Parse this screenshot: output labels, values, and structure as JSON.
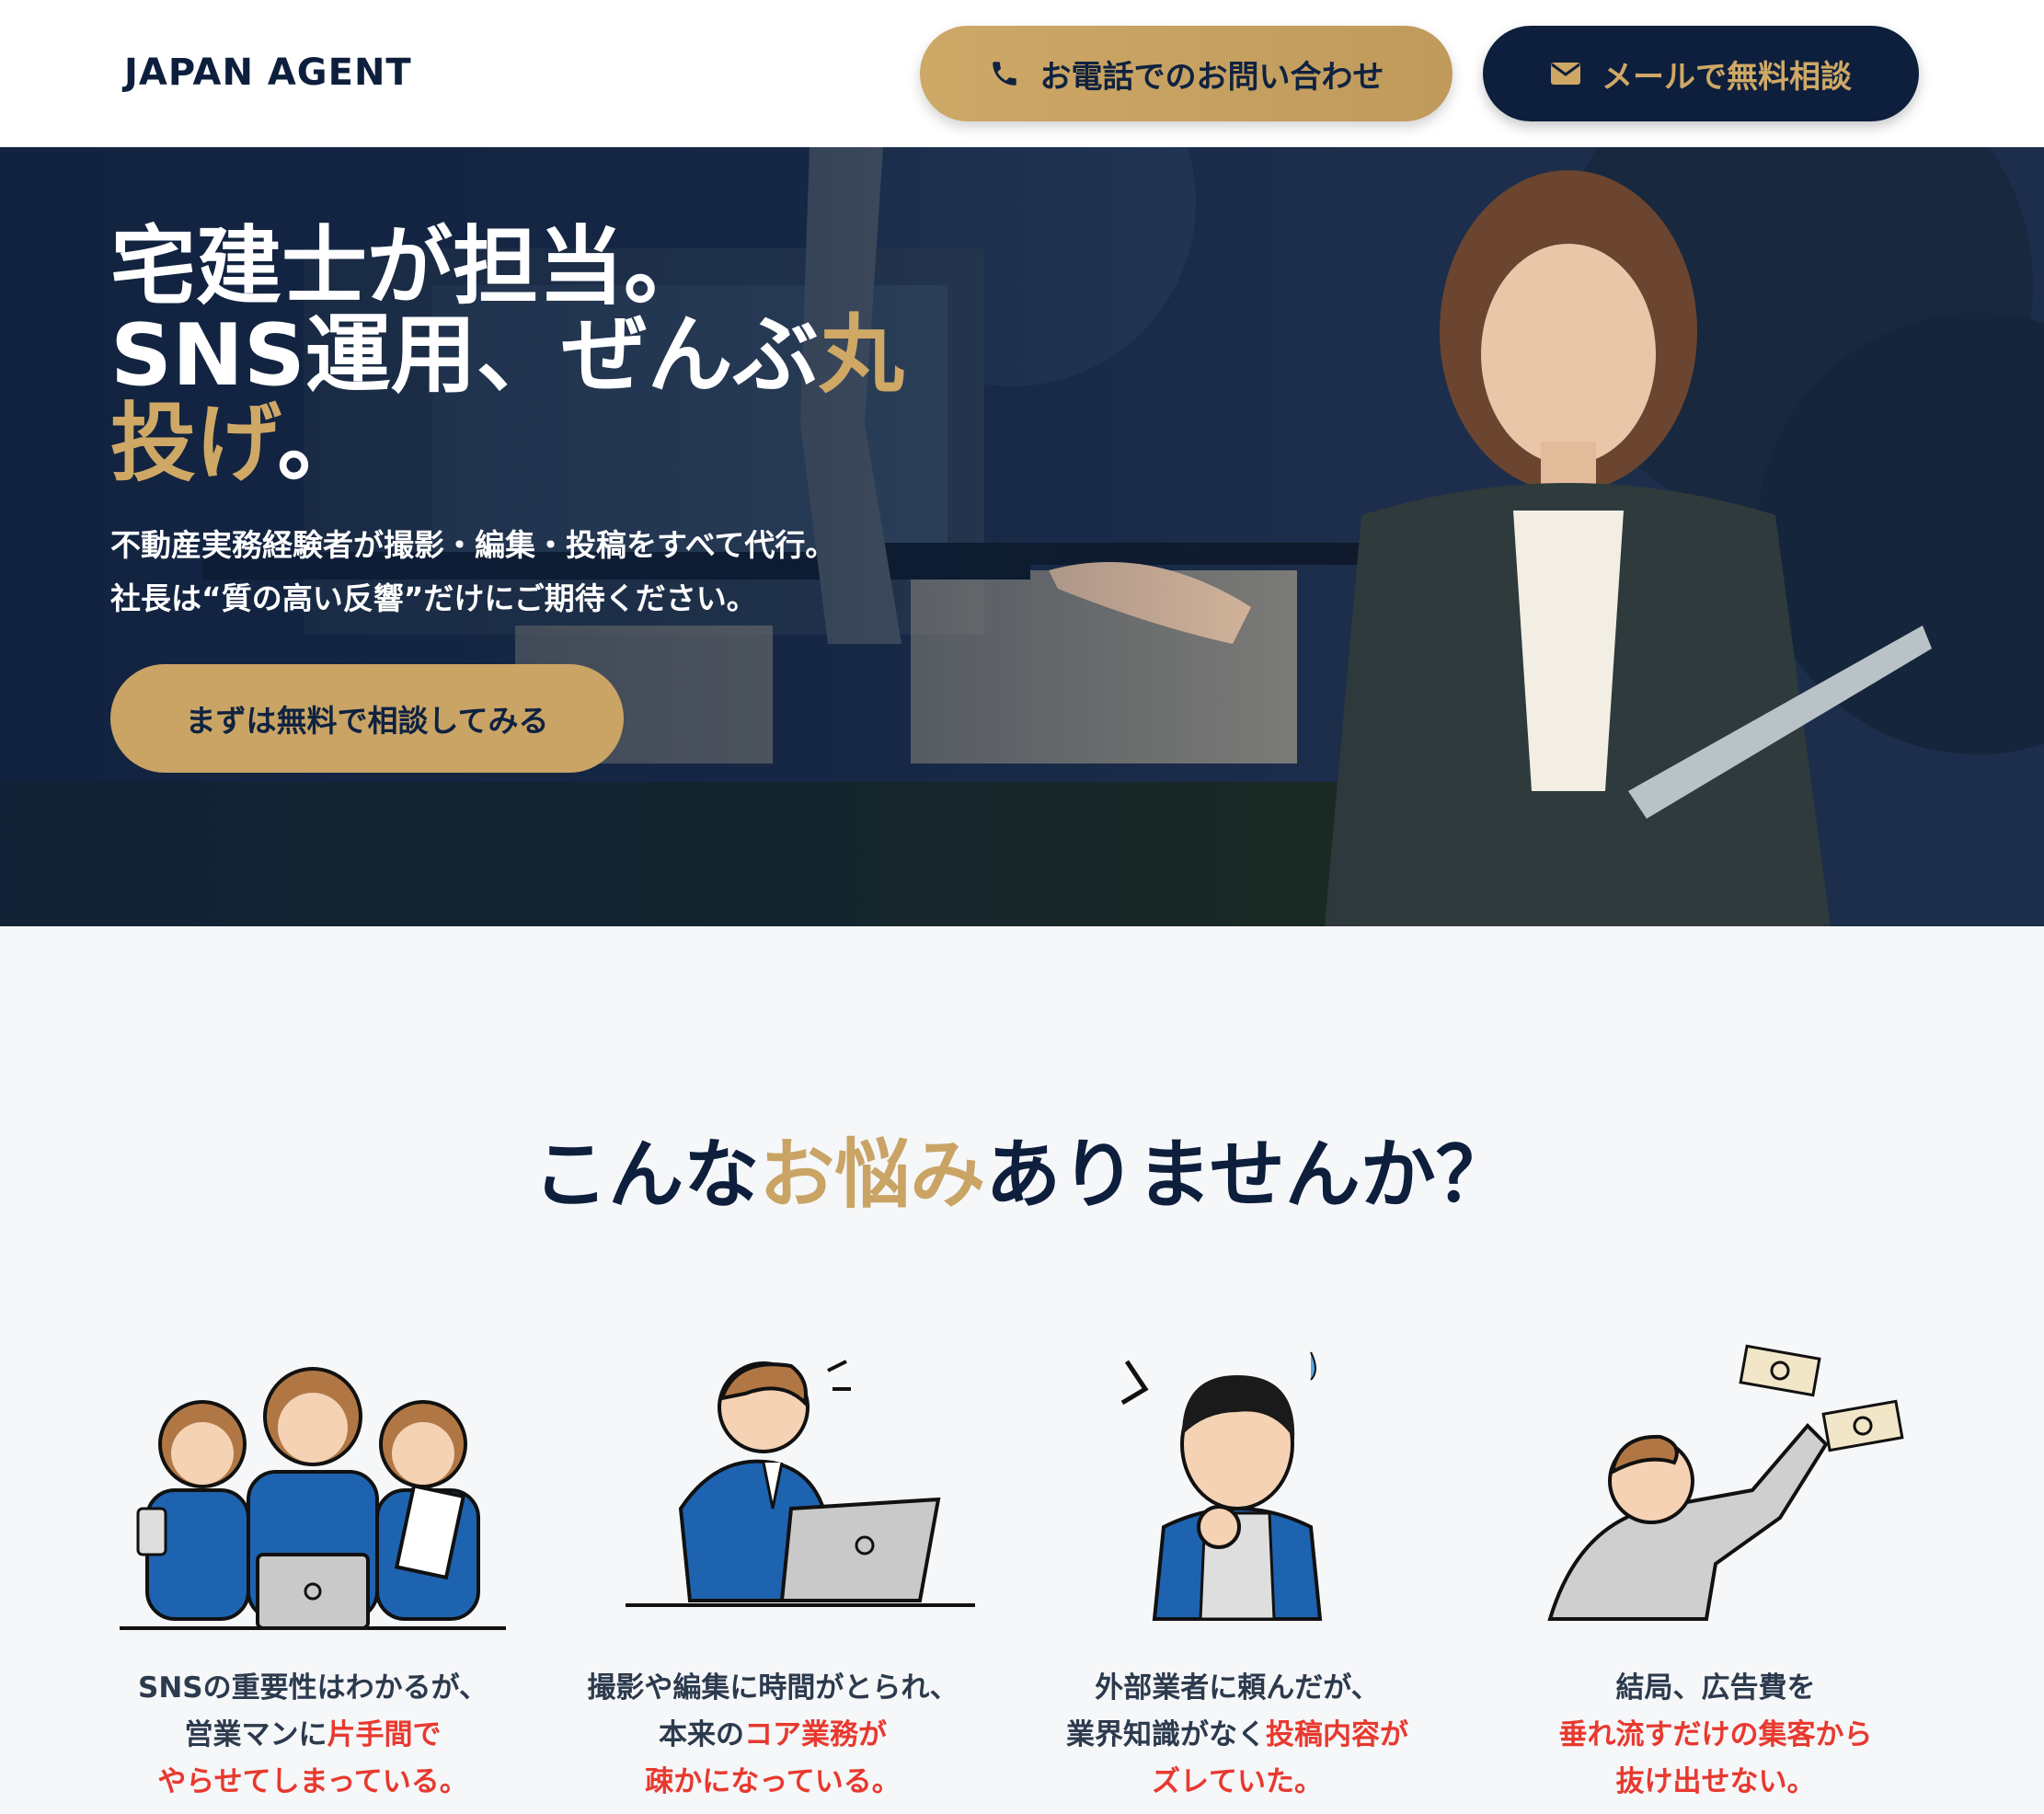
{
  "header": {
    "logo": "JAPAN AGENT",
    "phone_button": "お電話でのお問い合わせ",
    "mail_button": "メールで無料相談",
    "icons": {
      "phone": "phone-icon",
      "mail": "mail-icon"
    }
  },
  "hero": {
    "title_line1": "宅建士が担当。",
    "title_line2_a": "SNS運用、ぜんぶ",
    "title_line2_b": "丸",
    "title_line3_a": "投げ",
    "title_line3_b": "。",
    "sub_line1": "不動産実務経験者が撮影・編集・投稿をすべて代行。",
    "sub_line2": "社長は“質の高い反響”だけにご期待ください。",
    "cta": "まずは無料で相談してみる"
  },
  "problems": {
    "title_a": "こんな",
    "title_b": "お悩み",
    "title_c": "ありませんか？",
    "cards": [
      {
        "l1": "SNSの重要性はわかるが、",
        "l2a": "営業マンに",
        "l2b": "片手間で",
        "l3": "やらせてしまっている。"
      },
      {
        "l1": "撮影や編集に時間がとられ、",
        "l2a": "本来の",
        "l2b": "コア業務が",
        "l3": "疎かになっている。"
      },
      {
        "l1": "外部業者に頼んだが、",
        "l2a": "業界知識がなく",
        "l2b": "投稿内容が",
        "l3": "ズレていた。"
      },
      {
        "l1": "結局、広告費を",
        "l2a": "",
        "l2b": "垂れ流すだけの集客から",
        "l3": "抜け出せない。"
      }
    ]
  },
  "colors": {
    "navy": "#0d1f3c",
    "gold": "#c9a465",
    "red": "#e8392f"
  }
}
